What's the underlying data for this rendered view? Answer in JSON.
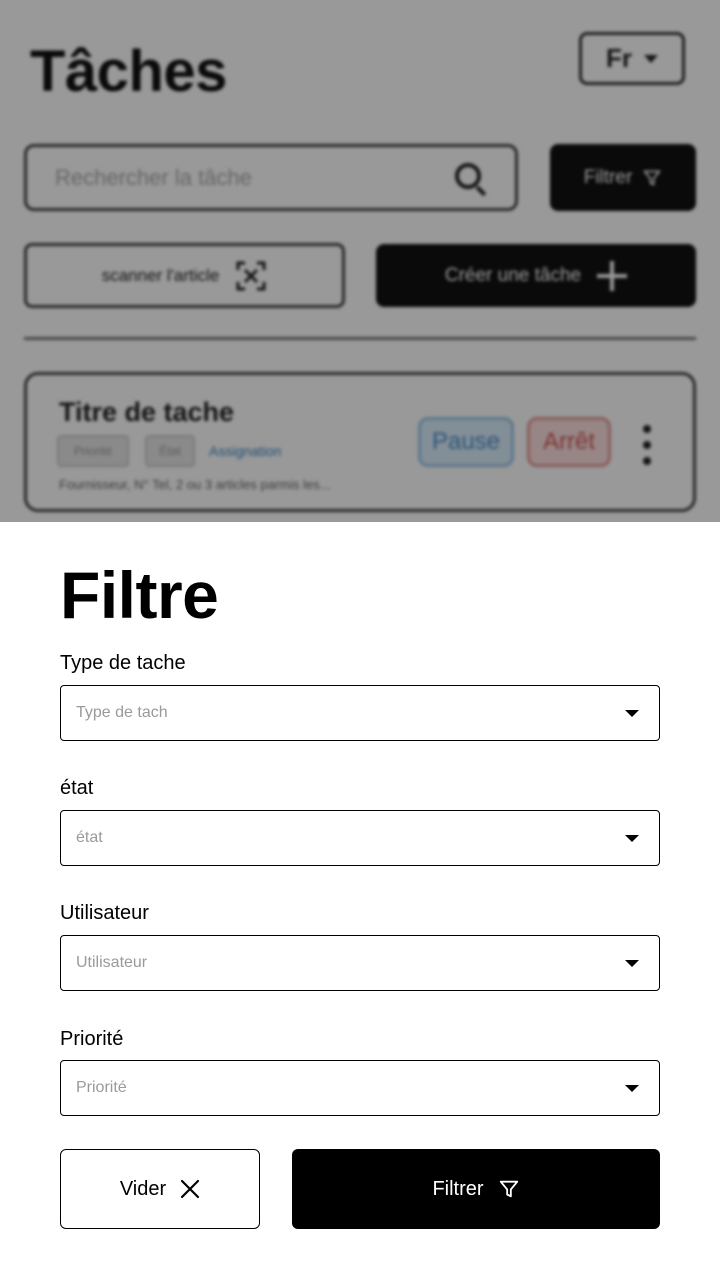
{
  "background": {
    "title": "Tâches",
    "language": "Fr",
    "search": {
      "placeholder": "Rechercher la tâche"
    },
    "filter_button": "Filtrer",
    "scan_button": "scanner l'article",
    "create_button": "Créer une tâche",
    "task_card": {
      "title": "Titre de tache",
      "chips": [
        "Priorité",
        "État"
      ],
      "link": "Assignation",
      "description": "Fournisseur, N° Tel, 2 ou 3 articles parmis les...",
      "pause_label": "Pause",
      "stop_label": "Arrêt"
    }
  },
  "filter_sheet": {
    "title": "Filtre",
    "fields": [
      {
        "label": "Type de tache",
        "placeholder": "Type de tach"
      },
      {
        "label": "état",
        "placeholder": "état"
      },
      {
        "label": "Utilisateur",
        "placeholder": "Utilisateur"
      },
      {
        "label": "Priorité",
        "placeholder": "Priorité"
      }
    ],
    "clear_button": "Vider",
    "apply_button": "Filtrer"
  },
  "colors": {
    "primary": "#000000",
    "pause_blue": "#4a8fc9",
    "stop_red": "#d05656",
    "placeholder_gray": "#9a9a9a"
  },
  "icons": [
    "chevron-down-icon",
    "search-icon",
    "filter-icon",
    "scan-icon",
    "plus-icon",
    "kebab-icon",
    "close-icon"
  ]
}
